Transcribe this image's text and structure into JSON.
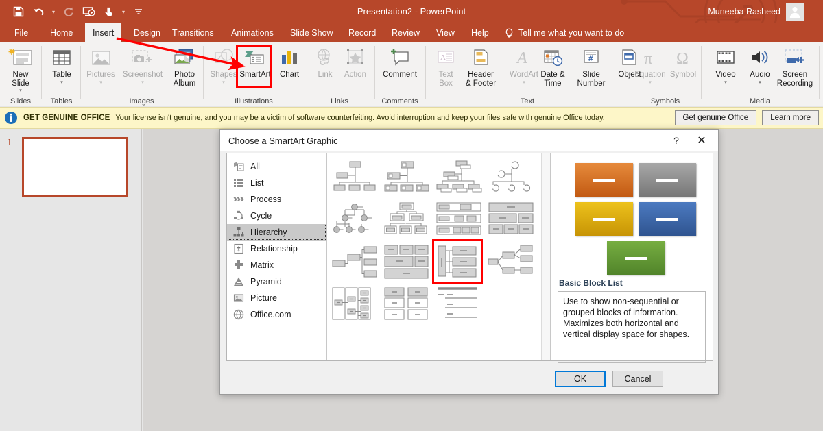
{
  "titlebar": {
    "document_title": "Presentation2  -  PowerPoint",
    "user_name": "Muneeba Rasheed",
    "accent_color": "#b7472a",
    "qat": [
      {
        "name": "save-icon",
        "label": "Save"
      },
      {
        "name": "undo-icon",
        "label": "Undo"
      },
      {
        "name": "redo-icon",
        "label": "Redo"
      },
      {
        "name": "start-from-beginning-icon",
        "label": "Start From Beginning"
      },
      {
        "name": "touch-mode-icon",
        "label": "Touch/Mouse Mode"
      },
      {
        "name": "customize-qat-icon",
        "label": "Customize Quick Access Toolbar"
      }
    ]
  },
  "tabs": [
    {
      "label": "File",
      "active": false
    },
    {
      "label": "Home",
      "active": false
    },
    {
      "label": "Insert",
      "active": true
    },
    {
      "label": "Design",
      "active": false
    },
    {
      "label": "Transitions",
      "active": false
    },
    {
      "label": "Animations",
      "active": false
    },
    {
      "label": "Slide Show",
      "active": false
    },
    {
      "label": "Record",
      "active": false
    },
    {
      "label": "Review",
      "active": false
    },
    {
      "label": "View",
      "active": false
    },
    {
      "label": "Help",
      "active": false
    }
  ],
  "tell_me": "Tell me what you want to do",
  "ribbon": {
    "groups": [
      {
        "label": "Slides",
        "items": [
          {
            "label": "New\nSlide",
            "icon": "new-slide-icon",
            "dropdown": true,
            "disabled": false
          }
        ]
      },
      {
        "label": "Tables",
        "items": [
          {
            "label": "Table",
            "icon": "table-icon",
            "dropdown": true,
            "disabled": false
          }
        ]
      },
      {
        "label": "Images",
        "items": [
          {
            "label": "Pictures",
            "icon": "pictures-icon",
            "dropdown": true,
            "disabled": true
          },
          {
            "label": "Screenshot",
            "icon": "screenshot-icon",
            "dropdown": true,
            "disabled": true
          },
          {
            "label": "Photo\nAlbum",
            "icon": "photo-album-icon",
            "dropdown": true,
            "disabled": false
          }
        ]
      },
      {
        "label": "Illustrations",
        "items": [
          {
            "label": "Shapes",
            "icon": "shapes-icon",
            "dropdown": true,
            "disabled": true
          },
          {
            "label": "SmartArt",
            "icon": "smartart-icon",
            "dropdown": false,
            "disabled": false,
            "highlighted": true
          },
          {
            "label": "Chart",
            "icon": "chart-icon",
            "dropdown": false,
            "disabled": false
          }
        ]
      },
      {
        "label": "Links",
        "items": [
          {
            "label": "Link",
            "icon": "link-icon",
            "dropdown": false,
            "disabled": true
          },
          {
            "label": "Action",
            "icon": "action-icon",
            "dropdown": false,
            "disabled": true
          }
        ]
      },
      {
        "label": "Comments",
        "items": [
          {
            "label": "Comment",
            "icon": "comment-icon",
            "dropdown": false,
            "disabled": false
          }
        ]
      },
      {
        "label": "Text",
        "items": [
          {
            "label": "Text\nBox",
            "icon": "text-box-icon",
            "dropdown": false,
            "disabled": true
          },
          {
            "label": "Header\n& Footer",
            "icon": "header-footer-icon",
            "dropdown": false,
            "disabled": false
          },
          {
            "label": "WordArt",
            "icon": "wordart-icon",
            "dropdown": true,
            "disabled": true
          },
          {
            "label": "Date &\nTime",
            "icon": "date-time-icon",
            "dropdown": false,
            "disabled": false
          },
          {
            "label": "Slide\nNumber",
            "icon": "slide-number-icon",
            "dropdown": false,
            "disabled": false
          },
          {
            "label": "Object",
            "icon": "object-icon",
            "dropdown": false,
            "disabled": false
          }
        ]
      },
      {
        "label": "Symbols",
        "items": [
          {
            "label": "Equation",
            "icon": "equation-icon",
            "dropdown": true,
            "disabled": true
          },
          {
            "label": "Symbol",
            "icon": "symbol-icon",
            "dropdown": false,
            "disabled": true
          }
        ]
      },
      {
        "label": "Media",
        "items": [
          {
            "label": "Video",
            "icon": "video-icon",
            "dropdown": true,
            "disabled": false
          },
          {
            "label": "Audio",
            "icon": "audio-icon",
            "dropdown": true,
            "disabled": false
          },
          {
            "label": "Screen\nRecording",
            "icon": "screen-recording-icon",
            "dropdown": false,
            "disabled": false
          }
        ]
      }
    ]
  },
  "notification": {
    "icon": "info-icon",
    "heading": "GET GENUINE OFFICE",
    "message": "Your license isn't genuine, and you may be a victim of software counterfeiting. Avoid interruption and keep your files safe with genuine Office today.",
    "primary_button": "Get genuine Office",
    "secondary_button": "Learn more",
    "background_color": "#fdf6c8"
  },
  "slide_pane": {
    "slides": [
      {
        "number": "1"
      }
    ]
  },
  "dialog": {
    "title": "Choose a SmartArt Graphic",
    "help_icon": "?",
    "close_icon": "✕",
    "categories": [
      {
        "label": "All",
        "icon": "all-icon",
        "selected": false
      },
      {
        "label": "List",
        "icon": "list-icon",
        "selected": false
      },
      {
        "label": "Process",
        "icon": "process-icon",
        "selected": false
      },
      {
        "label": "Cycle",
        "icon": "cycle-icon",
        "selected": false
      },
      {
        "label": "Hierarchy",
        "icon": "hierarchy-icon",
        "selected": true
      },
      {
        "label": "Relationship",
        "icon": "relationship-icon",
        "selected": false
      },
      {
        "label": "Matrix",
        "icon": "matrix-icon",
        "selected": false
      },
      {
        "label": "Pyramid",
        "icon": "pyramid-icon",
        "selected": false
      },
      {
        "label": "Picture",
        "icon": "picture-icon",
        "selected": false
      },
      {
        "label": "Office.com",
        "icon": "office-com-icon",
        "selected": false
      }
    ],
    "gallery": {
      "columns": 4,
      "rows": 4,
      "selected_index": 10,
      "items": [
        {
          "name": "organization-chart",
          "layout": "org1"
        },
        {
          "name": "picture-organization-chart",
          "layout": "org2"
        },
        {
          "name": "name-and-title-organization-chart",
          "layout": "org3"
        },
        {
          "name": "half-circle-organization-chart",
          "layout": "org4"
        },
        {
          "name": "circle-picture-hierarchy",
          "layout": "circ"
        },
        {
          "name": "hierarchy-list",
          "layout": "hierlist"
        },
        {
          "name": "labeled-hierarchy",
          "layout": "labhier"
        },
        {
          "name": "table-hierarchy",
          "layout": "tablehier"
        },
        {
          "name": "horizontal-hierarchy",
          "layout": "horzhier"
        },
        {
          "name": "architecture-layout",
          "layout": "arch"
        },
        {
          "name": "basic-block-list",
          "layout": "basicblock"
        },
        {
          "name": "horizontal-multi-level-hierarchy",
          "layout": "multilevel"
        },
        {
          "name": "horizontal-organization-chart",
          "layout": "horzorg"
        },
        {
          "name": "lined-list",
          "layout": "linedlist"
        },
        {
          "name": "hierarchy-table-list",
          "layout": "hiertable"
        },
        {
          "name": "empty-slot",
          "layout": "none"
        }
      ]
    },
    "preview": {
      "name": "Basic Block List",
      "description": "Use to show non-sequential or grouped blocks of information. Maximizes both horizontal and vertical display space for shapes.",
      "shapes": [
        {
          "color": "#e07b28",
          "color2": "#c25a12"
        },
        {
          "color": "#9b9b9b",
          "color2": "#7b7b7b"
        },
        {
          "color": "#e8b40b",
          "color2": "#c79405"
        },
        {
          "color": "#3f6aab",
          "color2": "#2f5490"
        },
        {
          "color": "#6a9e38",
          "color2": "#51842a"
        }
      ]
    },
    "ok_button": "OK",
    "cancel_button": "Cancel"
  },
  "annotations": {
    "arrow_color": "#ff0000",
    "highlight_color": "#ff0000"
  }
}
